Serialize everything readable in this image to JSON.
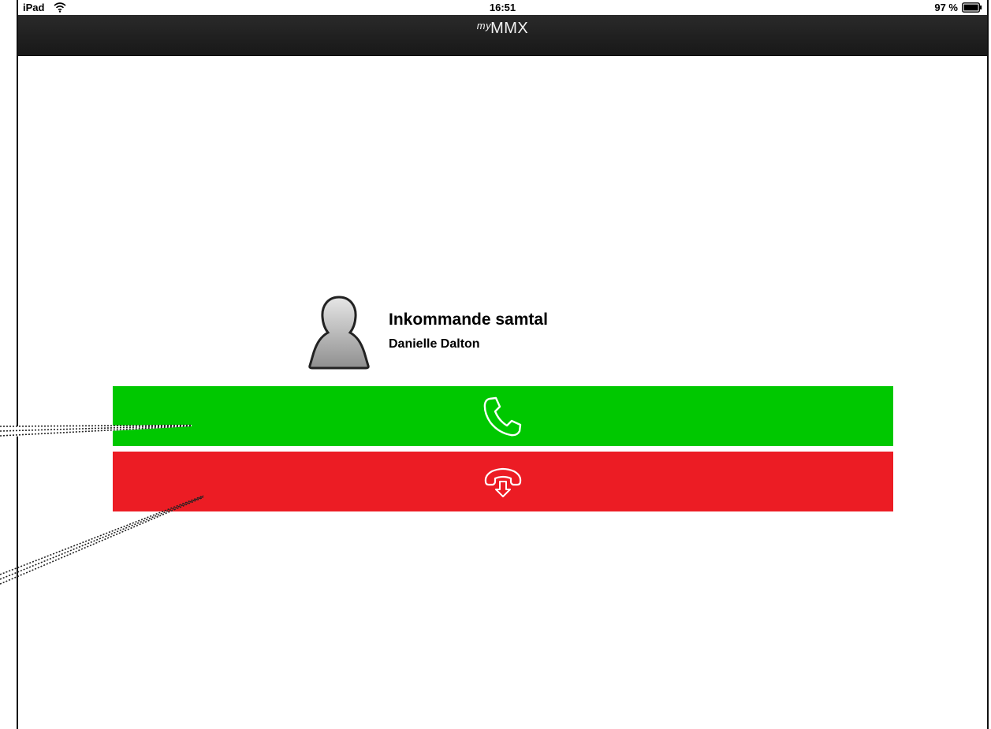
{
  "status_bar": {
    "device": "iPad",
    "time": "16:51",
    "battery": "97 %"
  },
  "nav_bar": {
    "title_prefix": "my",
    "title_main": "MMX"
  },
  "incoming_call": {
    "title": "Inkommande samtal",
    "caller": "Danielle Dalton"
  },
  "buttons": {
    "answer_icon": "phone-answer-icon",
    "answer_color": "#00c800",
    "decline_icon": "phone-hangup-icon",
    "decline_color": "#ec1c24"
  }
}
